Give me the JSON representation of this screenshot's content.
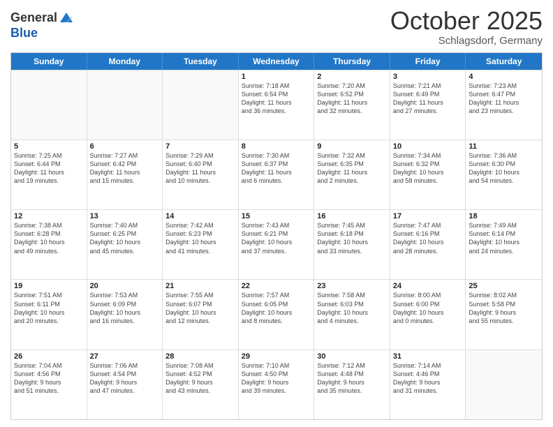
{
  "header": {
    "logo_general": "General",
    "logo_blue": "Blue",
    "title": "October 2025",
    "location": "Schlagsdorf, Germany"
  },
  "weekdays": [
    "Sunday",
    "Monday",
    "Tuesday",
    "Wednesday",
    "Thursday",
    "Friday",
    "Saturday"
  ],
  "rows": [
    [
      {
        "day": "",
        "info": ""
      },
      {
        "day": "",
        "info": ""
      },
      {
        "day": "",
        "info": ""
      },
      {
        "day": "1",
        "info": "Sunrise: 7:18 AM\nSunset: 6:54 PM\nDaylight: 11 hours\nand 36 minutes."
      },
      {
        "day": "2",
        "info": "Sunrise: 7:20 AM\nSunset: 6:52 PM\nDaylight: 11 hours\nand 32 minutes."
      },
      {
        "day": "3",
        "info": "Sunrise: 7:21 AM\nSunset: 6:49 PM\nDaylight: 11 hours\nand 27 minutes."
      },
      {
        "day": "4",
        "info": "Sunrise: 7:23 AM\nSunset: 6:47 PM\nDaylight: 11 hours\nand 23 minutes."
      }
    ],
    [
      {
        "day": "5",
        "info": "Sunrise: 7:25 AM\nSunset: 6:44 PM\nDaylight: 11 hours\nand 19 minutes."
      },
      {
        "day": "6",
        "info": "Sunrise: 7:27 AM\nSunset: 6:42 PM\nDaylight: 11 hours\nand 15 minutes."
      },
      {
        "day": "7",
        "info": "Sunrise: 7:29 AM\nSunset: 6:40 PM\nDaylight: 11 hours\nand 10 minutes."
      },
      {
        "day": "8",
        "info": "Sunrise: 7:30 AM\nSunset: 6:37 PM\nDaylight: 11 hours\nand 6 minutes."
      },
      {
        "day": "9",
        "info": "Sunrise: 7:32 AM\nSunset: 6:35 PM\nDaylight: 11 hours\nand 2 minutes."
      },
      {
        "day": "10",
        "info": "Sunrise: 7:34 AM\nSunset: 6:32 PM\nDaylight: 10 hours\nand 58 minutes."
      },
      {
        "day": "11",
        "info": "Sunrise: 7:36 AM\nSunset: 6:30 PM\nDaylight: 10 hours\nand 54 minutes."
      }
    ],
    [
      {
        "day": "12",
        "info": "Sunrise: 7:38 AM\nSunset: 6:28 PM\nDaylight: 10 hours\nand 49 minutes."
      },
      {
        "day": "13",
        "info": "Sunrise: 7:40 AM\nSunset: 6:25 PM\nDaylight: 10 hours\nand 45 minutes."
      },
      {
        "day": "14",
        "info": "Sunrise: 7:42 AM\nSunset: 6:23 PM\nDaylight: 10 hours\nand 41 minutes."
      },
      {
        "day": "15",
        "info": "Sunrise: 7:43 AM\nSunset: 6:21 PM\nDaylight: 10 hours\nand 37 minutes."
      },
      {
        "day": "16",
        "info": "Sunrise: 7:45 AM\nSunset: 6:18 PM\nDaylight: 10 hours\nand 33 minutes."
      },
      {
        "day": "17",
        "info": "Sunrise: 7:47 AM\nSunset: 6:16 PM\nDaylight: 10 hours\nand 28 minutes."
      },
      {
        "day": "18",
        "info": "Sunrise: 7:49 AM\nSunset: 6:14 PM\nDaylight: 10 hours\nand 24 minutes."
      }
    ],
    [
      {
        "day": "19",
        "info": "Sunrise: 7:51 AM\nSunset: 6:11 PM\nDaylight: 10 hours\nand 20 minutes."
      },
      {
        "day": "20",
        "info": "Sunrise: 7:53 AM\nSunset: 6:09 PM\nDaylight: 10 hours\nand 16 minutes."
      },
      {
        "day": "21",
        "info": "Sunrise: 7:55 AM\nSunset: 6:07 PM\nDaylight: 10 hours\nand 12 minutes."
      },
      {
        "day": "22",
        "info": "Sunrise: 7:57 AM\nSunset: 6:05 PM\nDaylight: 10 hours\nand 8 minutes."
      },
      {
        "day": "23",
        "info": "Sunrise: 7:58 AM\nSunset: 6:03 PM\nDaylight: 10 hours\nand 4 minutes."
      },
      {
        "day": "24",
        "info": "Sunrise: 8:00 AM\nSunset: 6:00 PM\nDaylight: 10 hours\nand 0 minutes."
      },
      {
        "day": "25",
        "info": "Sunrise: 8:02 AM\nSunset: 5:58 PM\nDaylight: 9 hours\nand 55 minutes."
      }
    ],
    [
      {
        "day": "26",
        "info": "Sunrise: 7:04 AM\nSunset: 4:56 PM\nDaylight: 9 hours\nand 51 minutes."
      },
      {
        "day": "27",
        "info": "Sunrise: 7:06 AM\nSunset: 4:54 PM\nDaylight: 9 hours\nand 47 minutes."
      },
      {
        "day": "28",
        "info": "Sunrise: 7:08 AM\nSunset: 4:52 PM\nDaylight: 9 hours\nand 43 minutes."
      },
      {
        "day": "29",
        "info": "Sunrise: 7:10 AM\nSunset: 4:50 PM\nDaylight: 9 hours\nand 39 minutes."
      },
      {
        "day": "30",
        "info": "Sunrise: 7:12 AM\nSunset: 4:48 PM\nDaylight: 9 hours\nand 35 minutes."
      },
      {
        "day": "31",
        "info": "Sunrise: 7:14 AM\nSunset: 4:46 PM\nDaylight: 9 hours\nand 31 minutes."
      },
      {
        "day": "",
        "info": ""
      }
    ]
  ]
}
